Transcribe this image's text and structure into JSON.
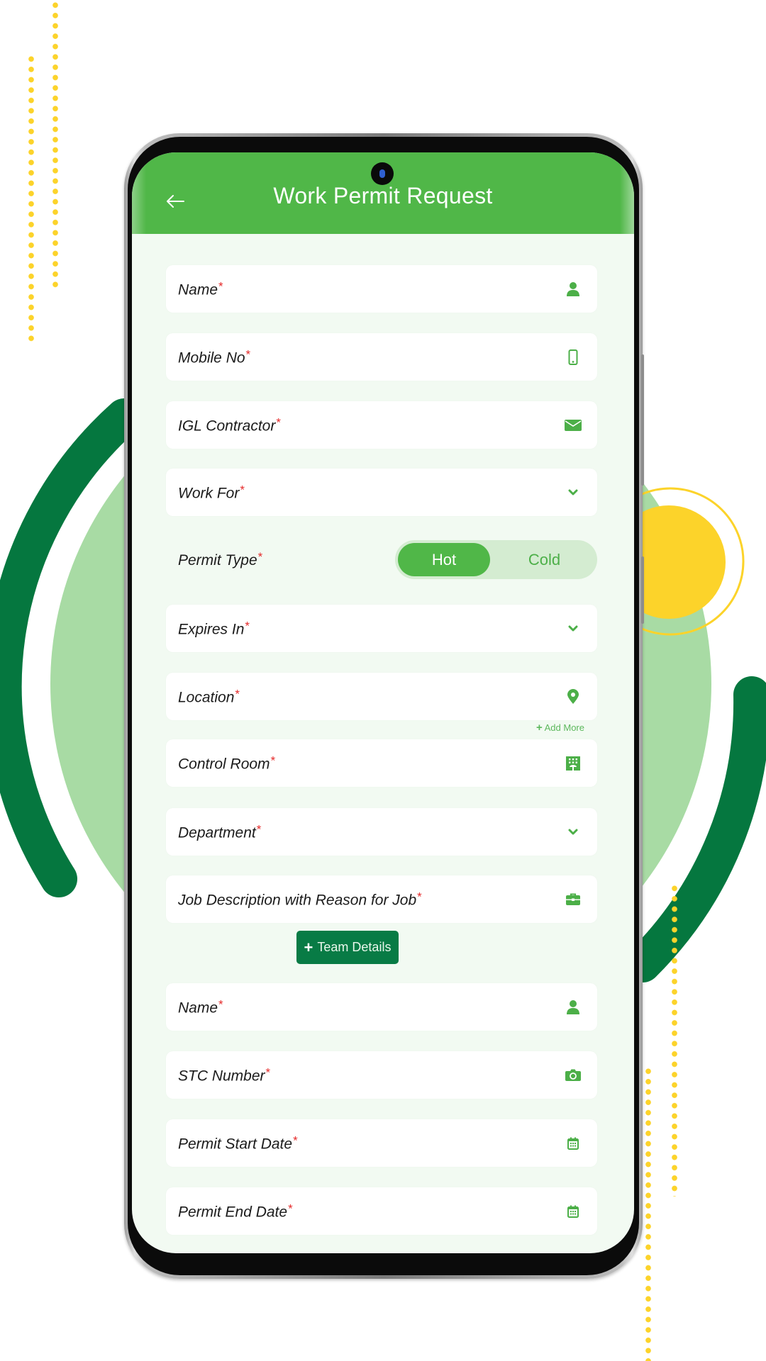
{
  "header": {
    "title": "Work Permit Request",
    "back_icon": "arrow-left-icon"
  },
  "form": {
    "required_marker": "*",
    "fields_top": [
      {
        "label": "Name",
        "icon": "user-icon",
        "type": "text"
      },
      {
        "label": "Mobile No",
        "icon": "mobile-phone-icon",
        "type": "text"
      },
      {
        "label": "IGL Contractor",
        "icon": "envelope-icon",
        "type": "text"
      },
      {
        "label": "Work For",
        "icon": "chevron-down-icon",
        "type": "dropdown"
      }
    ],
    "permit_type": {
      "label": "Permit Type",
      "options": [
        "Hot",
        "Cold"
      ],
      "selected": "Hot"
    },
    "fields_mid": [
      {
        "label": "Expires In",
        "icon": "chevron-down-icon",
        "type": "dropdown"
      },
      {
        "label": "Location",
        "icon": "map-pin-icon",
        "type": "text"
      }
    ],
    "add_more": {
      "icon": "plus-icon",
      "label": "Add More"
    },
    "fields_lower": [
      {
        "label": "Control Room",
        "icon": "building-icon",
        "type": "text"
      },
      {
        "label": "Department",
        "icon": "chevron-down-icon",
        "type": "dropdown"
      },
      {
        "label": "Job Description with Reason for Job",
        "icon": "briefcase-icon",
        "type": "text"
      }
    ],
    "team_button": {
      "icon": "plus-icon",
      "label": "Team Details"
    },
    "team_fields": [
      {
        "label": "Name",
        "icon": "user-icon",
        "type": "text"
      },
      {
        "label": "STC Number",
        "icon": "camera-icon",
        "type": "text"
      },
      {
        "label": "Permit Start Date",
        "icon": "calendar-icon",
        "type": "date"
      },
      {
        "label": "Permit End Date",
        "icon": "calendar-icon",
        "type": "date"
      }
    ]
  },
  "colors": {
    "primary_green": "#50b748",
    "dark_green": "#087b45",
    "light_green": "#a8dba4",
    "accent_yellow": "#fcd32a",
    "required_red": "#e52b2b",
    "screen_bg": "#f2faf2"
  }
}
